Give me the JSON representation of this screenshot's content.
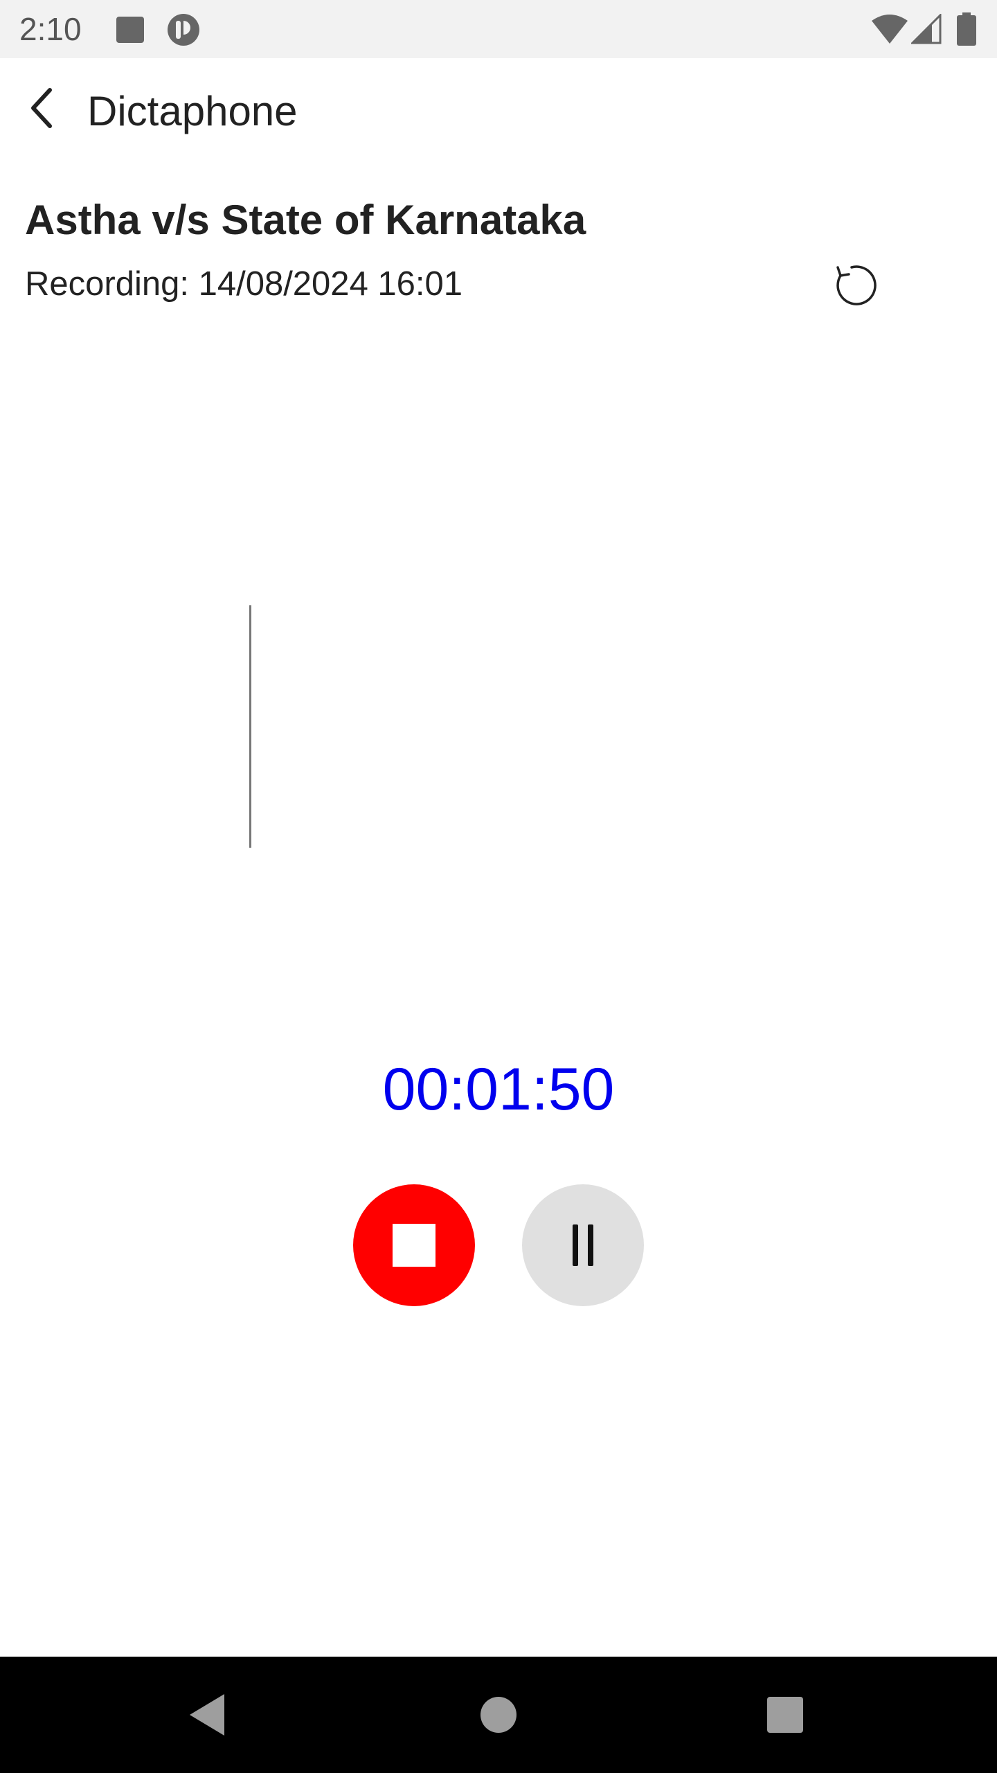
{
  "status_bar": {
    "time": "2:10",
    "icons": [
      "notification-square-icon",
      "app-notification-icon",
      "wifi-icon",
      "signal-icon",
      "battery-icon"
    ]
  },
  "app_bar": {
    "title": "Dictaphone",
    "back_icon": "chevron-left-icon"
  },
  "recording": {
    "title": "Astha v/s State of Karnataka",
    "subtitle": "Recording: 14/08/2024 16:01",
    "reset_icon": "reset-icon"
  },
  "timer": {
    "elapsed": "00:01:50",
    "color": "#0000ee"
  },
  "controls": {
    "stop": {
      "icon": "stop-icon",
      "color": "#ff0000"
    },
    "pause": {
      "icon": "pause-icon",
      "color": "#e0e0e0"
    }
  },
  "nav_bar": {
    "buttons": [
      "back-triangle-icon",
      "home-circle-icon",
      "recents-square-icon"
    ]
  }
}
